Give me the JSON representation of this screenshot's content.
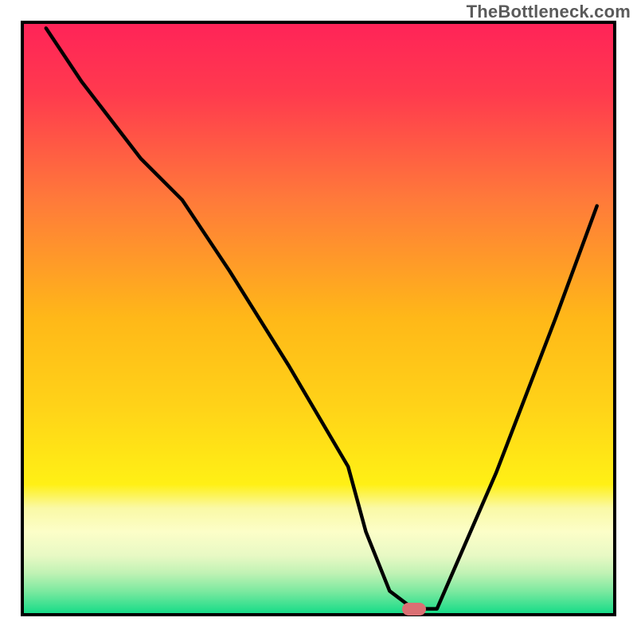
{
  "watermark": "TheBottleneck.com",
  "chart_data": {
    "type": "line",
    "title": "",
    "xlabel": "",
    "ylabel": "",
    "xlim": [
      0,
      100
    ],
    "ylim": [
      0,
      100
    ],
    "grid": false,
    "legend": false,
    "series": [
      {
        "name": "bottleneck-curve",
        "x": [
          4,
          10,
          20,
          27,
          35,
          45,
          55,
          58,
          62,
          66,
          70,
          80,
          90,
          97
        ],
        "y": [
          99,
          90,
          77,
          70,
          58,
          42,
          25,
          14,
          4,
          1,
          1,
          24,
          50,
          69
        ]
      }
    ],
    "marker": {
      "name": "optimal-zone",
      "x_center": 66,
      "y_center": 1,
      "color": "#db6f73"
    },
    "background_gradient": {
      "top_color": "#ff2358",
      "mid_color": "#ffd318",
      "lower_band_color": "#faf9a6",
      "bottom_color": "#10db86"
    },
    "frame_color": "#000000",
    "curve_color": "#000000"
  }
}
